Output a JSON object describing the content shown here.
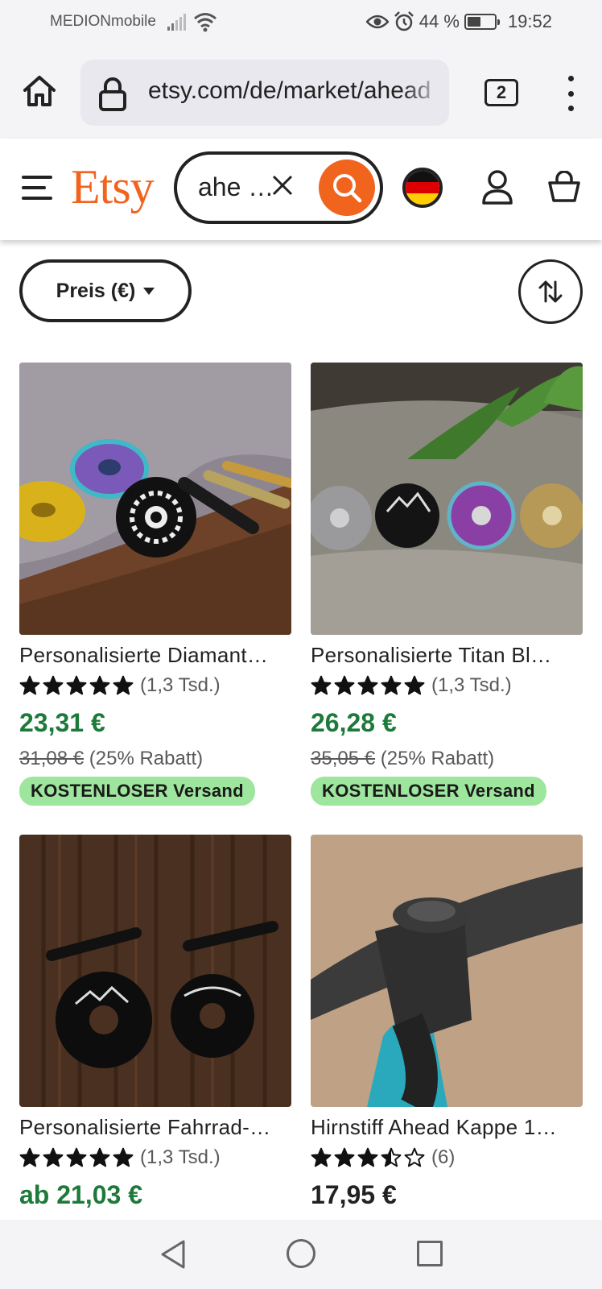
{
  "status_bar": {
    "carrier": "MEDIONmobile",
    "battery_text": "44 %",
    "battery_level": 0.44,
    "time": "19:52"
  },
  "browser": {
    "url": "etsy.com/de/market/ahead",
    "tab_count": "2"
  },
  "header": {
    "logo": "Etsy",
    "search_value": "ahe …",
    "region_flag": "Germany",
    "colors": {
      "brand": "#f1641e"
    }
  },
  "filters": {
    "price_label": "Preis (€)"
  },
  "products": [
    {
      "title": "Personalisierte Diamant…",
      "rating": 5,
      "rating_count": "(1,3 Tsd.)",
      "price": "23,31 €",
      "old_price": "31,08 €",
      "discount": "(25% Rabatt)",
      "shipping": "KOSTENLOSER Versand"
    },
    {
      "title": "Personalisierte Titan Bl…",
      "rating": 5,
      "rating_count": "(1,3 Tsd.)",
      "price": "26,28 €",
      "old_price": "35,05 €",
      "discount": "(25% Rabatt)",
      "shipping": "KOSTENLOSER Versand"
    },
    {
      "title": "Personalisierte Fahrrad-…",
      "rating": 5,
      "rating_count": "(1,3 Tsd.)",
      "price": "ab 21,03 €"
    },
    {
      "title": "Hirnstiff Ahead Kappe 1…",
      "rating": 3.5,
      "rating_count": "(6)",
      "price": "17,95 €"
    }
  ],
  "colors": {
    "sale_price": "#1d7a3a",
    "free_shipping_badge": "#9ee59e"
  }
}
